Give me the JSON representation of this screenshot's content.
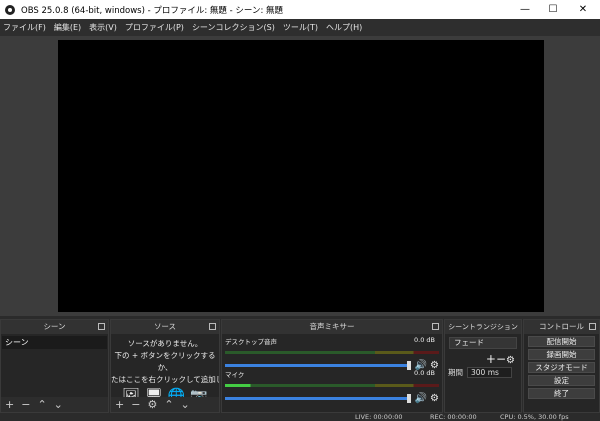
{
  "titlebar": {
    "title": "OBS 25.0.8 (64-bit, windows) - プロファイル: 無題 - シーン: 無題",
    "minimize": "—",
    "maximize": "☐",
    "close": "✕"
  },
  "menu": [
    "ファイル(F)",
    "編集(E)",
    "表示(V)",
    "プロファイル(P)",
    "シーンコレクション(S)",
    "ツール(T)",
    "ヘルプ(H)"
  ],
  "docks": {
    "scenes": {
      "title": "シーン",
      "items": [
        "シーン"
      ]
    },
    "sources": {
      "title": "ソース",
      "empty_line1": "ソースがありません。",
      "empty_line2": "下の + ボタンをクリックするか、",
      "empty_line3": "たはここを右クリックして追加してください"
    },
    "mixer": {
      "title": "音声ミキサー",
      "channels": [
        {
          "name": "デスクトップ音声",
          "db": "0.0 dB",
          "level": 0
        },
        {
          "name": "マイク",
          "db": "0.0 dB",
          "level": 0.12
        }
      ]
    },
    "transitions": {
      "title": "シーントランジション",
      "selected": "フェード",
      "duration_label": "期間",
      "duration": "300 ms"
    },
    "controls": {
      "title": "コントロール",
      "buttons": [
        "配信開始",
        "録画開始",
        "スタジオモード",
        "設定",
        "終了"
      ]
    }
  },
  "status": {
    "live": "LIVE: 00:00:00",
    "rec": "REC: 00:00:00",
    "cpu": "CPU: 0.5%, 30.00 fps"
  }
}
